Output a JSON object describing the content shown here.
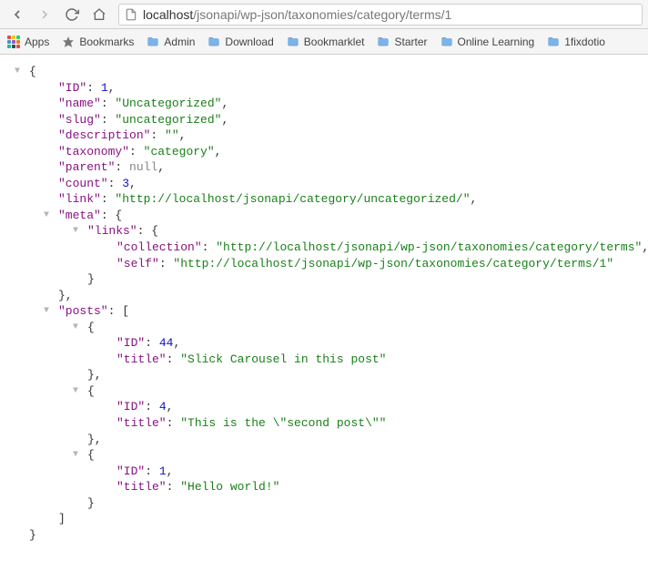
{
  "url": {
    "host": "localhost",
    "path": "/jsonapi/wp-json/taxonomies/category/terms/1"
  },
  "bookmarks": {
    "apps": "Apps",
    "items": [
      {
        "label": "Bookmarks",
        "type": "star"
      },
      {
        "label": "Admin",
        "type": "folder"
      },
      {
        "label": "Download",
        "type": "folder"
      },
      {
        "label": "Bookmarklet",
        "type": "folder"
      },
      {
        "label": "Starter",
        "type": "folder"
      },
      {
        "label": "Online Learning",
        "type": "folder"
      },
      {
        "label": "1fixdotio",
        "type": "folder"
      }
    ]
  },
  "json": {
    "ID": 1,
    "name": "Uncategorized",
    "slug": "uncategorized",
    "description": "",
    "taxonomy": "category",
    "parent_null": "null",
    "count": 3,
    "link": "http://localhost/jsonapi/category/uncategorized/",
    "meta_links_collection": "http://localhost/jsonapi/wp-json/taxonomies/category/terms",
    "meta_links_self": "http://localhost/jsonapi/wp-json/taxonomies/category/terms/1",
    "posts": [
      {
        "ID": 44,
        "title": "Slick Carousel in this post"
      },
      {
        "ID": 4,
        "title": "This is the \\\"second post\\\""
      },
      {
        "ID": 1,
        "title": "Hello world!"
      }
    ]
  },
  "keys": {
    "ID": "\"ID\"",
    "name": "\"name\"",
    "slug": "\"slug\"",
    "description": "\"description\"",
    "taxonomy": "\"taxonomy\"",
    "parent": "\"parent\"",
    "count": "\"count\"",
    "link": "\"link\"",
    "meta": "\"meta\"",
    "links": "\"links\"",
    "collection": "\"collection\"",
    "self": "\"self\"",
    "posts": "\"posts\"",
    "title": "\"title\""
  }
}
